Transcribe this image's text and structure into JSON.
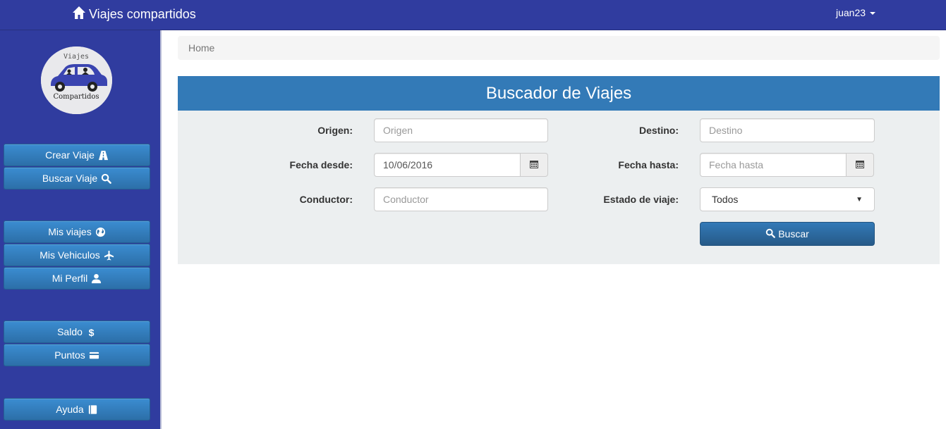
{
  "navbar": {
    "brand": "Viajes compartidos",
    "user": "juan23"
  },
  "logo": {
    "top_text": "Viajes",
    "bottom_text": "Compartidos"
  },
  "sidebar": {
    "items": [
      {
        "label": "Crear Viaje",
        "icon": "road-icon"
      },
      {
        "label": "Buscar Viaje",
        "icon": "search-icon"
      },
      {
        "label": "Mis viajes",
        "icon": "globe-icon"
      },
      {
        "label": "Mis Vehiculos",
        "icon": "plane-icon"
      },
      {
        "label": "Mi Perfil",
        "icon": "user-icon"
      },
      {
        "label": "Saldo",
        "icon": "dollar-icon"
      },
      {
        "label": "Puntos",
        "icon": "credit-card-icon"
      },
      {
        "label": "Ayuda",
        "icon": "book-icon"
      }
    ]
  },
  "breadcrumb": {
    "home": "Home"
  },
  "search_panel": {
    "title": "Buscador de Viajes",
    "origen": {
      "label": "Origen:",
      "placeholder": "Origen"
    },
    "destino": {
      "label": "Destino:",
      "placeholder": "Destino"
    },
    "fecha_desde": {
      "label": "Fecha desde:",
      "value": "10/06/2016"
    },
    "fecha_hasta": {
      "label": "Fecha hasta:",
      "placeholder": "Fecha hasta"
    },
    "conductor": {
      "label": "Conductor:",
      "placeholder": "Conductor"
    },
    "estado": {
      "label": "Estado de viaje:",
      "value": "Todos"
    },
    "search_button": "Buscar"
  },
  "colors": {
    "navbar": "#303c9f",
    "panel_header": "#337ab7",
    "button": "#2c6fa8"
  }
}
